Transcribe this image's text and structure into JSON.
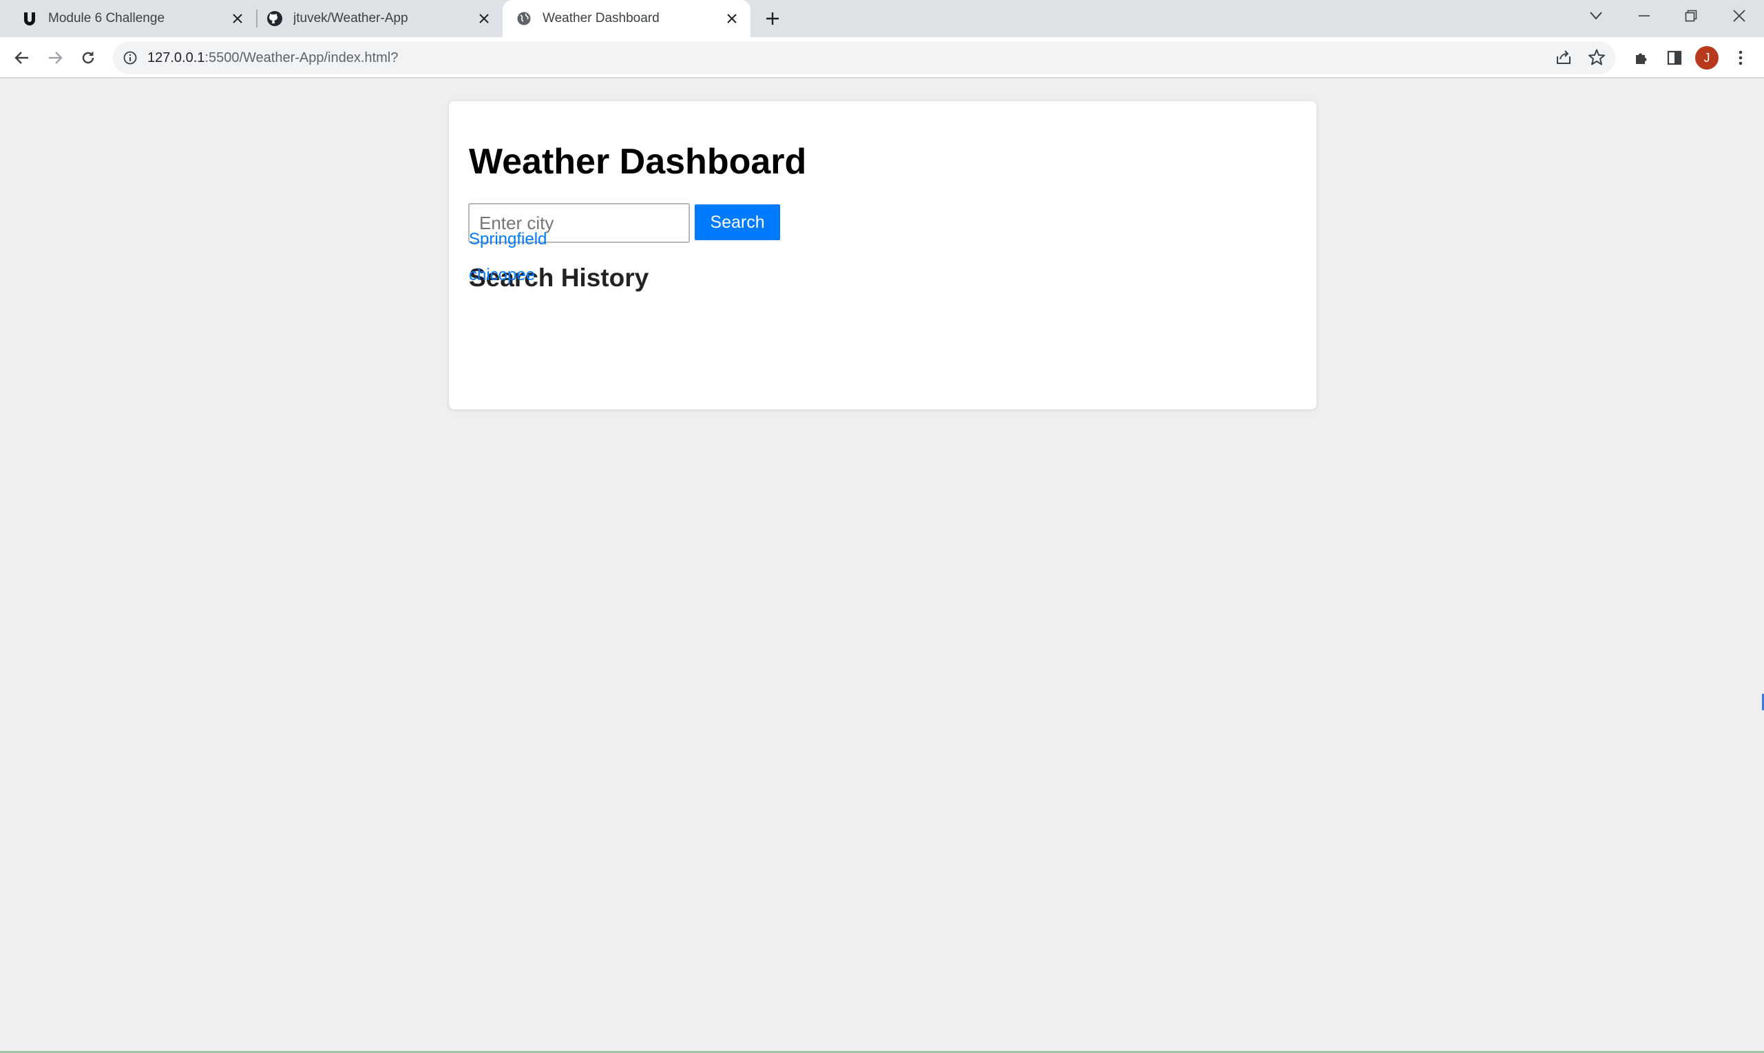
{
  "browser": {
    "tabs": [
      {
        "title": "Module 6 Challenge",
        "favicon": "u-logo-icon",
        "active": false
      },
      {
        "title": "jtuvek/Weather-App",
        "favicon": "github-icon",
        "active": false
      },
      {
        "title": "Weather Dashboard",
        "favicon": "globe-icon",
        "active": true
      }
    ],
    "url_host": "127.0.0.1",
    "url_rest": ":5500/Weather-App/index.html?",
    "avatar_letter": "J",
    "avatar_color": "#b83a1c"
  },
  "page": {
    "title": "Weather Dashboard",
    "search": {
      "placeholder": "Enter city",
      "value": "",
      "button_label": "Search",
      "button_color": "#007bff"
    },
    "history": {
      "title": "Search History",
      "items": [
        "Springfield",
        "chicopee"
      ],
      "link_color": "#007bff"
    }
  }
}
